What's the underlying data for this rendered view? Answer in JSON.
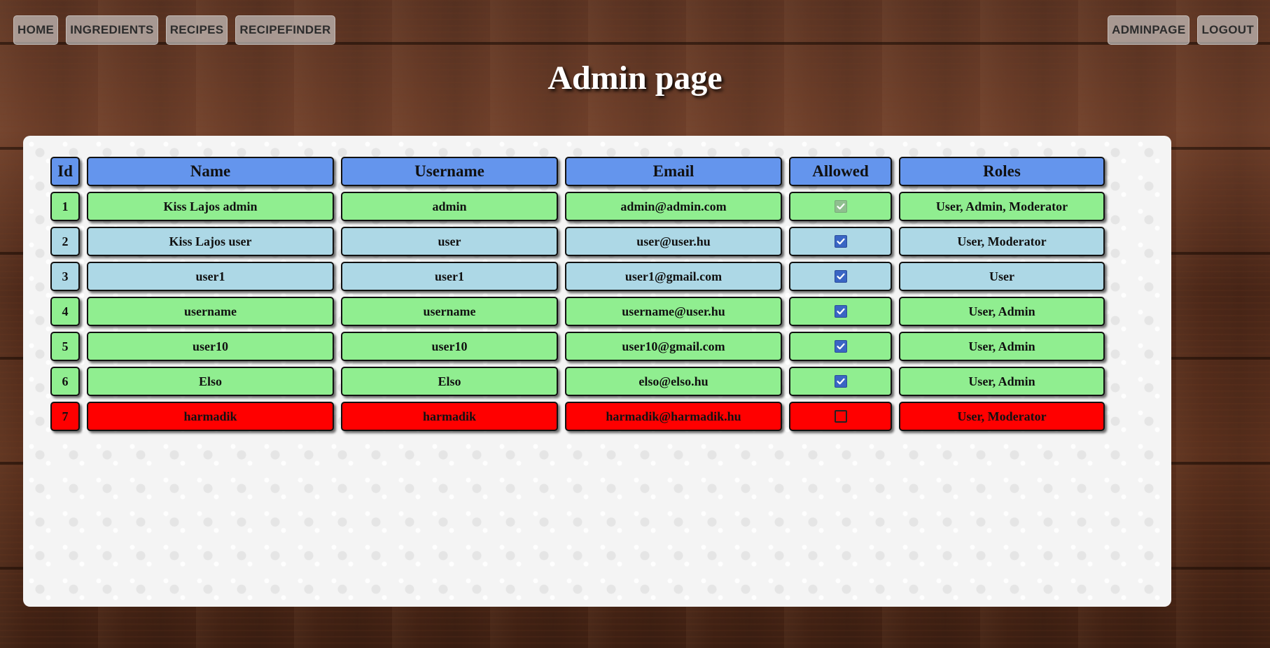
{
  "nav": {
    "left": [
      {
        "label": "HOME"
      },
      {
        "label": "INGREDIENTS"
      },
      {
        "label": "RECIPES"
      },
      {
        "label": "RECIPEFINDER"
      }
    ],
    "right": [
      {
        "label": "ADMINPAGE"
      },
      {
        "label": "LOGOUT"
      }
    ]
  },
  "page": {
    "title": "Admin page"
  },
  "table": {
    "headers": {
      "id": "Id",
      "name": "Name",
      "username": "Username",
      "email": "Email",
      "allowed": "Allowed",
      "roles": "Roles"
    },
    "rows": [
      {
        "id": "1",
        "name": "Kiss Lajos admin",
        "username": "admin",
        "email": "admin@admin.com",
        "allowed": true,
        "allowed_editable": false,
        "roles": "User, Admin, Moderator",
        "row_color": "#90ee90"
      },
      {
        "id": "2",
        "name": "Kiss Lajos user",
        "username": "user",
        "email": "user@user.hu",
        "allowed": true,
        "allowed_editable": true,
        "roles": "User, Moderator",
        "row_color": "#add8e6"
      },
      {
        "id": "3",
        "name": "user1",
        "username": "user1",
        "email": "user1@gmail.com",
        "allowed": true,
        "allowed_editable": true,
        "roles": "User",
        "row_color": "#add8e6"
      },
      {
        "id": "4",
        "name": "username",
        "username": "username",
        "email": "username@user.hu",
        "allowed": true,
        "allowed_editable": true,
        "roles": "User, Admin",
        "row_color": "#90ee90"
      },
      {
        "id": "5",
        "name": "user10",
        "username": "user10",
        "email": "user10@gmail.com",
        "allowed": true,
        "allowed_editable": true,
        "roles": "User, Admin",
        "row_color": "#90ee90"
      },
      {
        "id": "6",
        "name": "Elso",
        "username": "Elso",
        "email": "elso@elso.hu",
        "allowed": true,
        "allowed_editable": true,
        "roles": "User, Admin",
        "row_color": "#90ee90"
      },
      {
        "id": "7",
        "name": "harmadik",
        "username": "harmadik",
        "email": "harmadik@harmadik.hu",
        "allowed": false,
        "allowed_editable": true,
        "roles": "User, Moderator",
        "row_color": "#ff0000"
      }
    ]
  },
  "colors": {
    "header": "#6495ed",
    "admin_row": "#90ee90",
    "moderator_row": "#add8e6",
    "disallowed_row": "#ff0000"
  },
  "icons": {
    "checked": "checkbox-checked-icon",
    "unchecked": "checkbox-unchecked-icon"
  }
}
